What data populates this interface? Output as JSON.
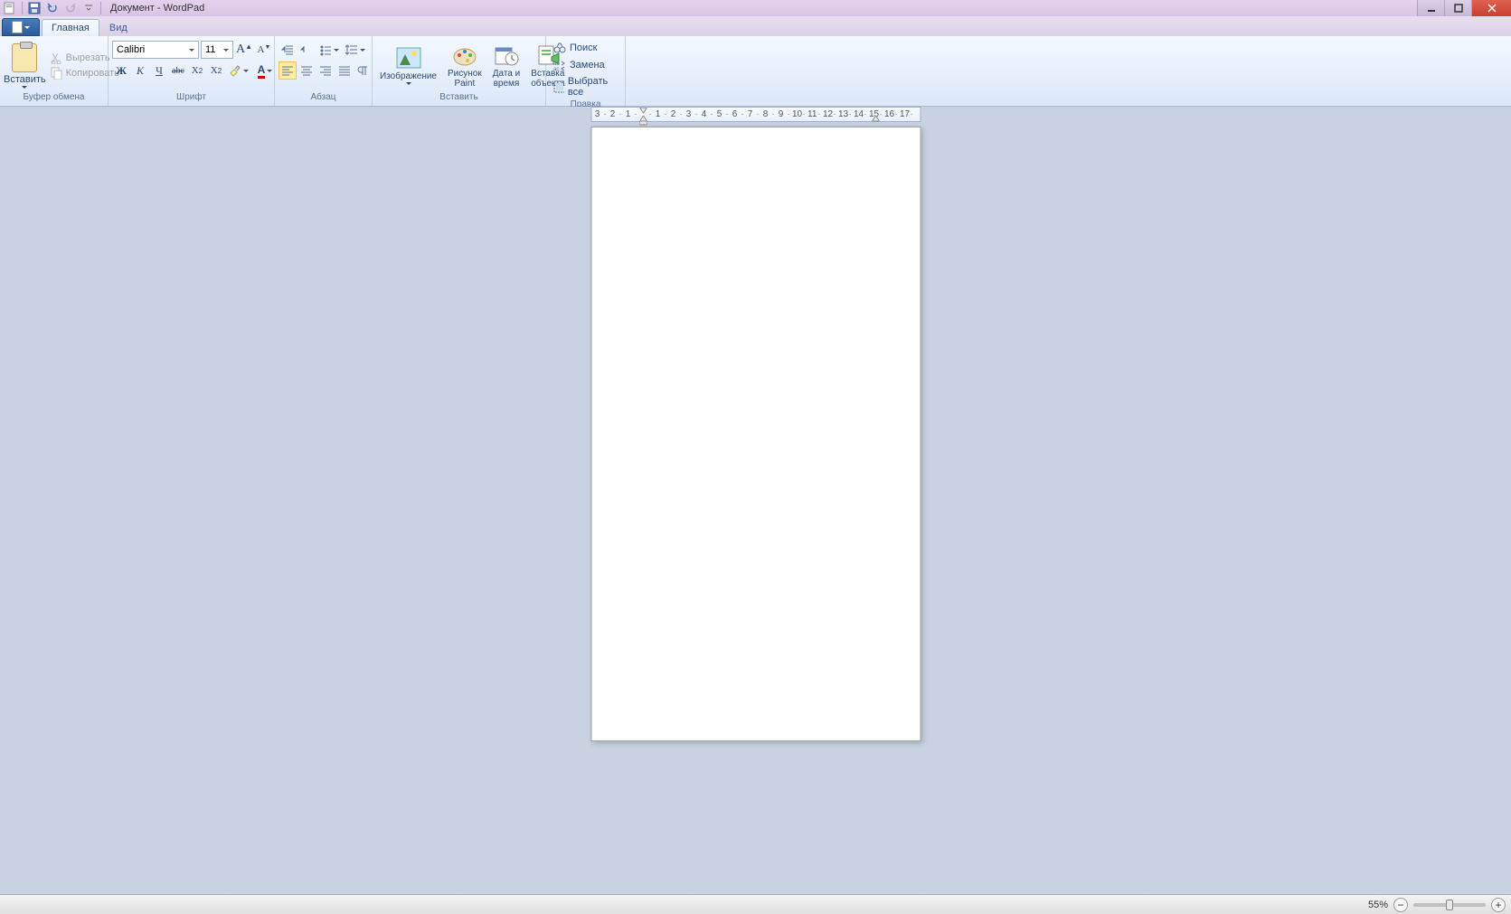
{
  "window": {
    "title": "Документ - WordPad"
  },
  "tabs": {
    "home": "Главная",
    "view": "Вид"
  },
  "clipboard": {
    "paste": "Вставить",
    "cut": "Вырезать",
    "copy": "Копировать",
    "group_label": "Буфер обмена"
  },
  "font": {
    "name": "Calibri",
    "size": "11",
    "grow_tooltip": "A",
    "shrink_tooltip": "A",
    "bold": "Ж",
    "italic": "К",
    "underline": "Ч",
    "strike": "abc",
    "subscript": "X₂",
    "superscript": "X²",
    "color_letter": "A",
    "group_label": "Шрифт"
  },
  "paragraph": {
    "group_label": "Абзац"
  },
  "insert": {
    "image": "Изображение",
    "paint": "Рисунок\nPaint",
    "datetime": "Дата и\nвремя",
    "object": "Вставка\nобъекта",
    "group_label": "Вставить"
  },
  "editing": {
    "find": "Поиск",
    "replace": "Замена",
    "select_all": "Выбрать все",
    "group_label": "Правка"
  },
  "ruler": {
    "marks": [
      "3",
      "·",
      "2",
      "·",
      "1",
      "·",
      " ",
      "·",
      "1",
      "·",
      "2",
      "·",
      "3",
      "·",
      "4",
      "·",
      "5",
      "·",
      "6",
      "·",
      "7",
      "·",
      "8",
      "·",
      "9",
      "·",
      "10",
      "·",
      "11",
      "·",
      "12",
      "·",
      "13",
      "·",
      "14",
      "·",
      "15",
      "·",
      "16",
      "·",
      "17",
      "·"
    ]
  },
  "status": {
    "zoom_pct": "55%",
    "zoom_slider_pct": 45
  }
}
